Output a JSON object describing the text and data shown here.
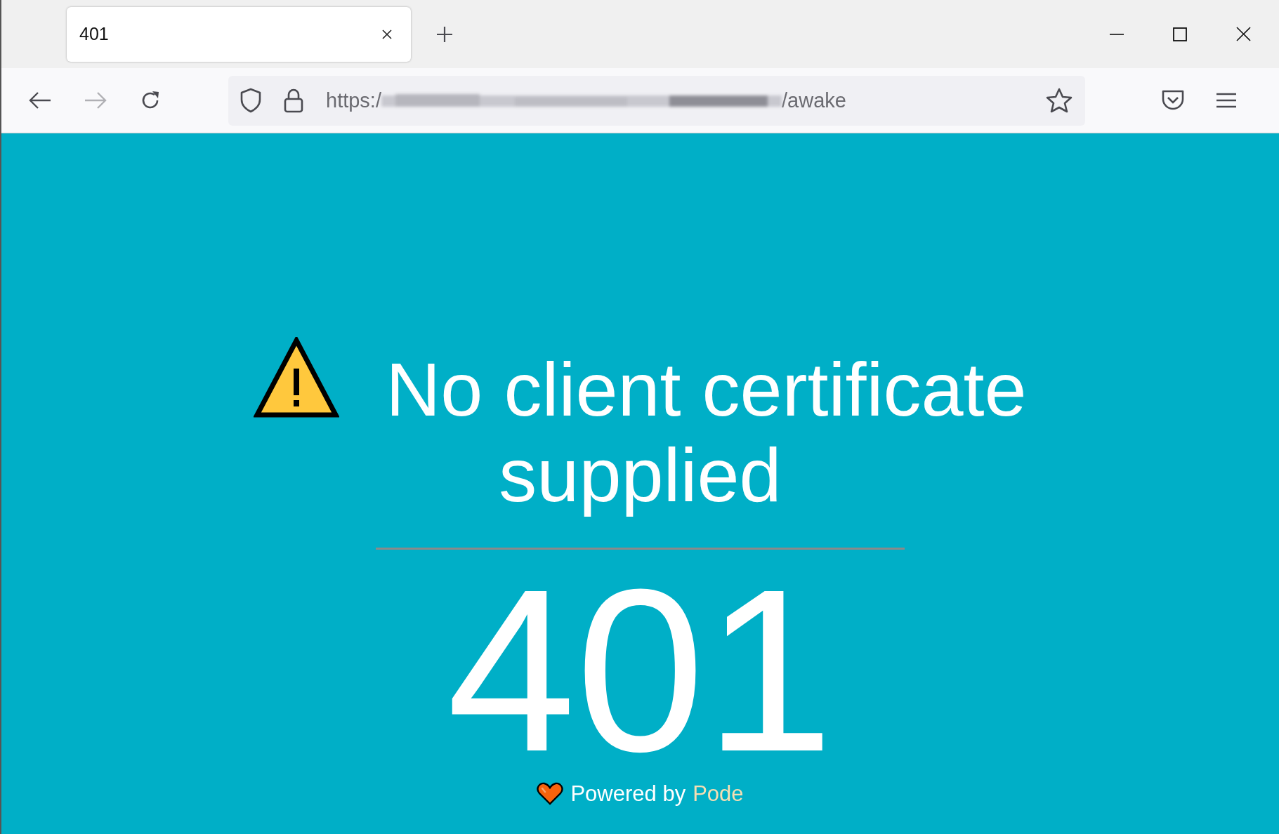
{
  "tabs": [
    {
      "title": "401",
      "selected": true
    }
  ],
  "toolbar": {
    "back_disabled": false,
    "forward_disabled": true
  },
  "address_bar": {
    "url_start": "https:/",
    "url_end": "/awake"
  },
  "page": {
    "heading": "No client certificate supplied",
    "status_code": "401",
    "footer": {
      "text": "Powered by",
      "link": "Pode"
    }
  }
}
